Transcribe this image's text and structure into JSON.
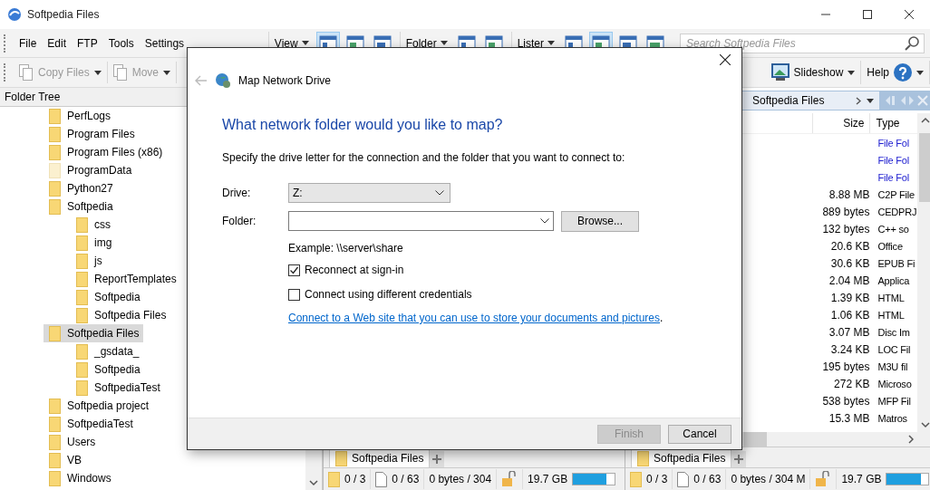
{
  "window": {
    "title": "Softpedia Files"
  },
  "menu": [
    "File",
    "Edit",
    "FTP",
    "Tools",
    "Settings"
  ],
  "layout_groups": [
    {
      "label": "View",
      "buttons": [
        {
          "selected": true
        },
        {
          "selected": false
        },
        {
          "selected": false
        }
      ]
    },
    {
      "label": "Folder",
      "buttons": [
        {
          "selected": false
        },
        {
          "selected": false
        }
      ]
    },
    {
      "label": "Lister",
      "buttons": [
        {
          "selected": false
        },
        {
          "selected": true
        },
        {
          "selected": false
        },
        {
          "selected": false
        }
      ]
    }
  ],
  "search": {
    "placeholder": "Search Softpedia Files"
  },
  "toolbar_left": [
    {
      "label": "Copy Files",
      "disabled": true
    },
    {
      "label": "Move",
      "disabled": true
    }
  ],
  "toolbar_right": [
    {
      "label": "Slideshow",
      "kind": "slideshow",
      "disabled": false
    },
    {
      "label": "Help",
      "kind": "help",
      "disabled": false
    }
  ],
  "folder_tree": {
    "title": "Folder Tree",
    "items": [
      {
        "label": "PerfLogs",
        "selected": false,
        "hidden": false
      },
      {
        "label": "Program Files",
        "selected": false,
        "hidden": false
      },
      {
        "label": "Program Files (x86)",
        "selected": false,
        "hidden": false
      },
      {
        "label": "ProgramData",
        "selected": false,
        "hidden": true
      },
      {
        "label": "Python27",
        "selected": false,
        "hidden": false
      },
      {
        "label": "Softpedia",
        "selected": false,
        "hidden": false,
        "children": [
          {
            "label": "css",
            "selected": false,
            "hidden": false
          },
          {
            "label": "img",
            "selected": false,
            "hidden": false
          },
          {
            "label": "js",
            "selected": false,
            "hidden": false
          },
          {
            "label": "ReportTemplates",
            "selected": false,
            "hidden": false
          },
          {
            "label": "Softpedia",
            "selected": false,
            "hidden": false
          },
          {
            "label": "Softpedia Files",
            "selected": false,
            "hidden": false
          }
        ]
      },
      {
        "label": "Softpedia Files",
        "selected": true,
        "hidden": false,
        "children": [
          {
            "label": "_gsdata_",
            "selected": false,
            "hidden": false
          },
          {
            "label": "Softpedia",
            "selected": false,
            "hidden": false
          },
          {
            "label": "SoftpediaTest",
            "selected": false,
            "hidden": false
          }
        ]
      },
      {
        "label": "Softpedia project",
        "selected": false,
        "hidden": false
      },
      {
        "label": "SoftpediaTest",
        "selected": false,
        "hidden": false
      },
      {
        "label": "Users",
        "selected": false,
        "hidden": false
      },
      {
        "label": "VB",
        "selected": false,
        "hidden": false
      },
      {
        "label": "Windows",
        "selected": false,
        "hidden": false
      }
    ]
  },
  "right_lister": {
    "breadcrumb": "Softpedia Files",
    "columns": [
      "Size",
      "Type"
    ],
    "rows": [
      {
        "kind": "folder",
        "type": "File Fol"
      },
      {
        "kind": "folder",
        "type": "File Fol"
      },
      {
        "kind": "folder",
        "type": "File Fol"
      },
      {
        "kind": "file",
        "size": "8.88 MB",
        "type": "C2P File"
      },
      {
        "kind": "file",
        "size": "889 bytes",
        "type": "CEDPRJ"
      },
      {
        "kind": "file",
        "size": "132 bytes",
        "type": "C++ so"
      },
      {
        "kind": "file",
        "size": "20.6 KB",
        "type": "Office"
      },
      {
        "kind": "file",
        "size": "30.6 KB",
        "type": "EPUB Fi"
      },
      {
        "kind": "file",
        "size": "2.04 MB",
        "type": "Applica"
      },
      {
        "kind": "file",
        "size": "1.39 KB",
        "type": "HTML"
      },
      {
        "kind": "file",
        "size": "1.06 KB",
        "type": "HTML"
      },
      {
        "kind": "file",
        "size": "3.07 MB",
        "type": "Disc Im"
      },
      {
        "kind": "file",
        "size": "3.24 KB",
        "type": "LOC Fil"
      },
      {
        "kind": "file",
        "size": "195 bytes",
        "type": "M3U fil"
      },
      {
        "kind": "file",
        "size": "272 KB",
        "type": "Microso"
      },
      {
        "kind": "file",
        "size": "538 bytes",
        "type": "MFP Fil"
      },
      {
        "kind": "file",
        "size": "15.3 MB",
        "type": "Matros"
      }
    ]
  },
  "panes": [
    {
      "tab": "Softpedia Files",
      "folders": "0 / 3",
      "files": "0 / 63",
      "bytes": "0 bytes / 304",
      "free": "19.7 GB",
      "level": 0.8
    },
    {
      "tab": "Softpedia Files",
      "folders": "0 / 3",
      "files": "0 / 63",
      "bytes": "0 bytes / 304 M",
      "free": "19.7 GB",
      "level": 0.82
    }
  ],
  "dialog": {
    "title": "Map Network Drive",
    "heading": "What network folder would you like to map?",
    "instruction": "Specify the drive letter for the connection and the folder that you want to connect to:",
    "drive": {
      "label": "Drive:",
      "value": "Z:"
    },
    "folder": {
      "label": "Folder:",
      "browse": "Browse..."
    },
    "example": "Example: \\\\server\\share",
    "checkboxes": [
      {
        "label": "Reconnect at sign-in",
        "checked": true
      },
      {
        "label": "Connect using different credentials",
        "checked": false
      }
    ],
    "link": "Connect to a Web site that you can use to store your documents and pictures",
    "link_suffix": ".",
    "buttons": [
      {
        "label": "Finish",
        "disabled": true
      },
      {
        "label": "Cancel",
        "disabled": false
      }
    ]
  }
}
